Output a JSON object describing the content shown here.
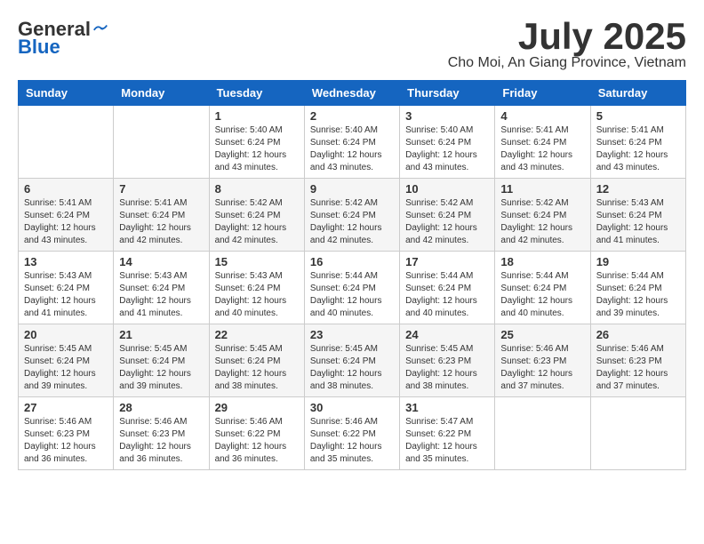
{
  "logo": {
    "general": "General",
    "blue": "Blue"
  },
  "title": {
    "month_year": "July 2025",
    "location": "Cho Moi, An Giang Province, Vietnam"
  },
  "calendar": {
    "headers": [
      "Sunday",
      "Monday",
      "Tuesday",
      "Wednesday",
      "Thursday",
      "Friday",
      "Saturday"
    ],
    "weeks": [
      [
        {
          "day": "",
          "info": ""
        },
        {
          "day": "",
          "info": ""
        },
        {
          "day": "1",
          "info": "Sunrise: 5:40 AM\nSunset: 6:24 PM\nDaylight: 12 hours and 43 minutes."
        },
        {
          "day": "2",
          "info": "Sunrise: 5:40 AM\nSunset: 6:24 PM\nDaylight: 12 hours and 43 minutes."
        },
        {
          "day": "3",
          "info": "Sunrise: 5:40 AM\nSunset: 6:24 PM\nDaylight: 12 hours and 43 minutes."
        },
        {
          "day": "4",
          "info": "Sunrise: 5:41 AM\nSunset: 6:24 PM\nDaylight: 12 hours and 43 minutes."
        },
        {
          "day": "5",
          "info": "Sunrise: 5:41 AM\nSunset: 6:24 PM\nDaylight: 12 hours and 43 minutes."
        }
      ],
      [
        {
          "day": "6",
          "info": "Sunrise: 5:41 AM\nSunset: 6:24 PM\nDaylight: 12 hours and 43 minutes."
        },
        {
          "day": "7",
          "info": "Sunrise: 5:41 AM\nSunset: 6:24 PM\nDaylight: 12 hours and 42 minutes."
        },
        {
          "day": "8",
          "info": "Sunrise: 5:42 AM\nSunset: 6:24 PM\nDaylight: 12 hours and 42 minutes."
        },
        {
          "day": "9",
          "info": "Sunrise: 5:42 AM\nSunset: 6:24 PM\nDaylight: 12 hours and 42 minutes."
        },
        {
          "day": "10",
          "info": "Sunrise: 5:42 AM\nSunset: 6:24 PM\nDaylight: 12 hours and 42 minutes."
        },
        {
          "day": "11",
          "info": "Sunrise: 5:42 AM\nSunset: 6:24 PM\nDaylight: 12 hours and 42 minutes."
        },
        {
          "day": "12",
          "info": "Sunrise: 5:43 AM\nSunset: 6:24 PM\nDaylight: 12 hours and 41 minutes."
        }
      ],
      [
        {
          "day": "13",
          "info": "Sunrise: 5:43 AM\nSunset: 6:24 PM\nDaylight: 12 hours and 41 minutes."
        },
        {
          "day": "14",
          "info": "Sunrise: 5:43 AM\nSunset: 6:24 PM\nDaylight: 12 hours and 41 minutes."
        },
        {
          "day": "15",
          "info": "Sunrise: 5:43 AM\nSunset: 6:24 PM\nDaylight: 12 hours and 40 minutes."
        },
        {
          "day": "16",
          "info": "Sunrise: 5:44 AM\nSunset: 6:24 PM\nDaylight: 12 hours and 40 minutes."
        },
        {
          "day": "17",
          "info": "Sunrise: 5:44 AM\nSunset: 6:24 PM\nDaylight: 12 hours and 40 minutes."
        },
        {
          "day": "18",
          "info": "Sunrise: 5:44 AM\nSunset: 6:24 PM\nDaylight: 12 hours and 40 minutes."
        },
        {
          "day": "19",
          "info": "Sunrise: 5:44 AM\nSunset: 6:24 PM\nDaylight: 12 hours and 39 minutes."
        }
      ],
      [
        {
          "day": "20",
          "info": "Sunrise: 5:45 AM\nSunset: 6:24 PM\nDaylight: 12 hours and 39 minutes."
        },
        {
          "day": "21",
          "info": "Sunrise: 5:45 AM\nSunset: 6:24 PM\nDaylight: 12 hours and 39 minutes."
        },
        {
          "day": "22",
          "info": "Sunrise: 5:45 AM\nSunset: 6:24 PM\nDaylight: 12 hours and 38 minutes."
        },
        {
          "day": "23",
          "info": "Sunrise: 5:45 AM\nSunset: 6:24 PM\nDaylight: 12 hours and 38 minutes."
        },
        {
          "day": "24",
          "info": "Sunrise: 5:45 AM\nSunset: 6:23 PM\nDaylight: 12 hours and 38 minutes."
        },
        {
          "day": "25",
          "info": "Sunrise: 5:46 AM\nSunset: 6:23 PM\nDaylight: 12 hours and 37 minutes."
        },
        {
          "day": "26",
          "info": "Sunrise: 5:46 AM\nSunset: 6:23 PM\nDaylight: 12 hours and 37 minutes."
        }
      ],
      [
        {
          "day": "27",
          "info": "Sunrise: 5:46 AM\nSunset: 6:23 PM\nDaylight: 12 hours and 36 minutes."
        },
        {
          "day": "28",
          "info": "Sunrise: 5:46 AM\nSunset: 6:23 PM\nDaylight: 12 hours and 36 minutes."
        },
        {
          "day": "29",
          "info": "Sunrise: 5:46 AM\nSunset: 6:22 PM\nDaylight: 12 hours and 36 minutes."
        },
        {
          "day": "30",
          "info": "Sunrise: 5:46 AM\nSunset: 6:22 PM\nDaylight: 12 hours and 35 minutes."
        },
        {
          "day": "31",
          "info": "Sunrise: 5:47 AM\nSunset: 6:22 PM\nDaylight: 12 hours and 35 minutes."
        },
        {
          "day": "",
          "info": ""
        },
        {
          "day": "",
          "info": ""
        }
      ]
    ]
  }
}
